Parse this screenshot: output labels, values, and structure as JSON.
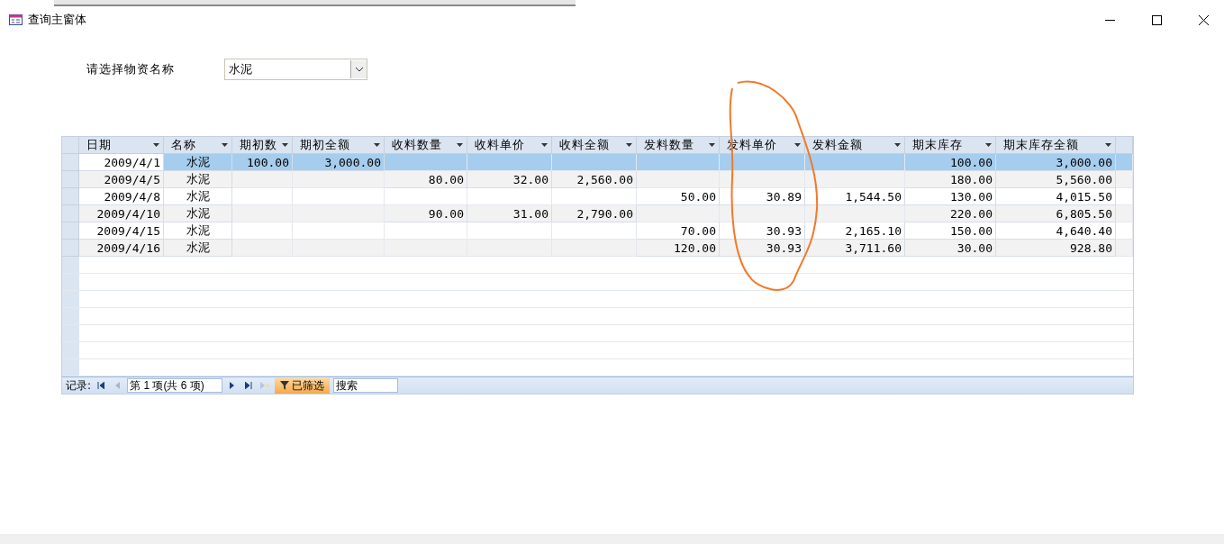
{
  "window": {
    "title": "查询主窗体"
  },
  "filter": {
    "label": "请选择物资名称",
    "value": "水泥"
  },
  "table": {
    "columns": [
      "日期",
      "名称",
      "期初数",
      "期初全额",
      "收料数量",
      "收料单价",
      "收料全额",
      "发料数量",
      "发料单价",
      "发料金额",
      "期末库存",
      "期末库存全额"
    ],
    "rows": [
      {
        "selected": true,
        "cells": [
          "2009/4/1",
          "水泥",
          "100.00",
          "3,000.00",
          null,
          null,
          null,
          null,
          null,
          null,
          "100.00",
          "3,000.00"
        ]
      },
      {
        "selected": false,
        "cells": [
          "2009/4/5",
          "水泥",
          null,
          null,
          "80.00",
          "32.00",
          "2,560.00",
          null,
          null,
          null,
          "180.00",
          "5,560.00"
        ]
      },
      {
        "selected": false,
        "cells": [
          "2009/4/8",
          "水泥",
          null,
          null,
          null,
          null,
          null,
          "50.00",
          "30.89",
          "1,544.50",
          "130.00",
          "4,015.50"
        ]
      },
      {
        "selected": false,
        "cells": [
          "2009/4/10",
          "水泥",
          null,
          null,
          "90.00",
          "31.00",
          "2,790.00",
          null,
          null,
          null,
          "220.00",
          "6,805.50"
        ]
      },
      {
        "selected": false,
        "cells": [
          "2009/4/15",
          "水泥",
          null,
          null,
          null,
          null,
          null,
          "70.00",
          "30.93",
          "2,165.10",
          "150.00",
          "4,640.40"
        ]
      },
      {
        "selected": false,
        "cells": [
          "2009/4/16",
          "水泥",
          null,
          null,
          null,
          null,
          null,
          "120.00",
          "30.93",
          "3,711.60",
          "30.00",
          "928.80"
        ]
      }
    ]
  },
  "navigation": {
    "label": "记录:",
    "position": "第 1 项(共 6 项)",
    "filter_button": "已筛选",
    "search": {
      "placeholder": "搜索"
    }
  }
}
